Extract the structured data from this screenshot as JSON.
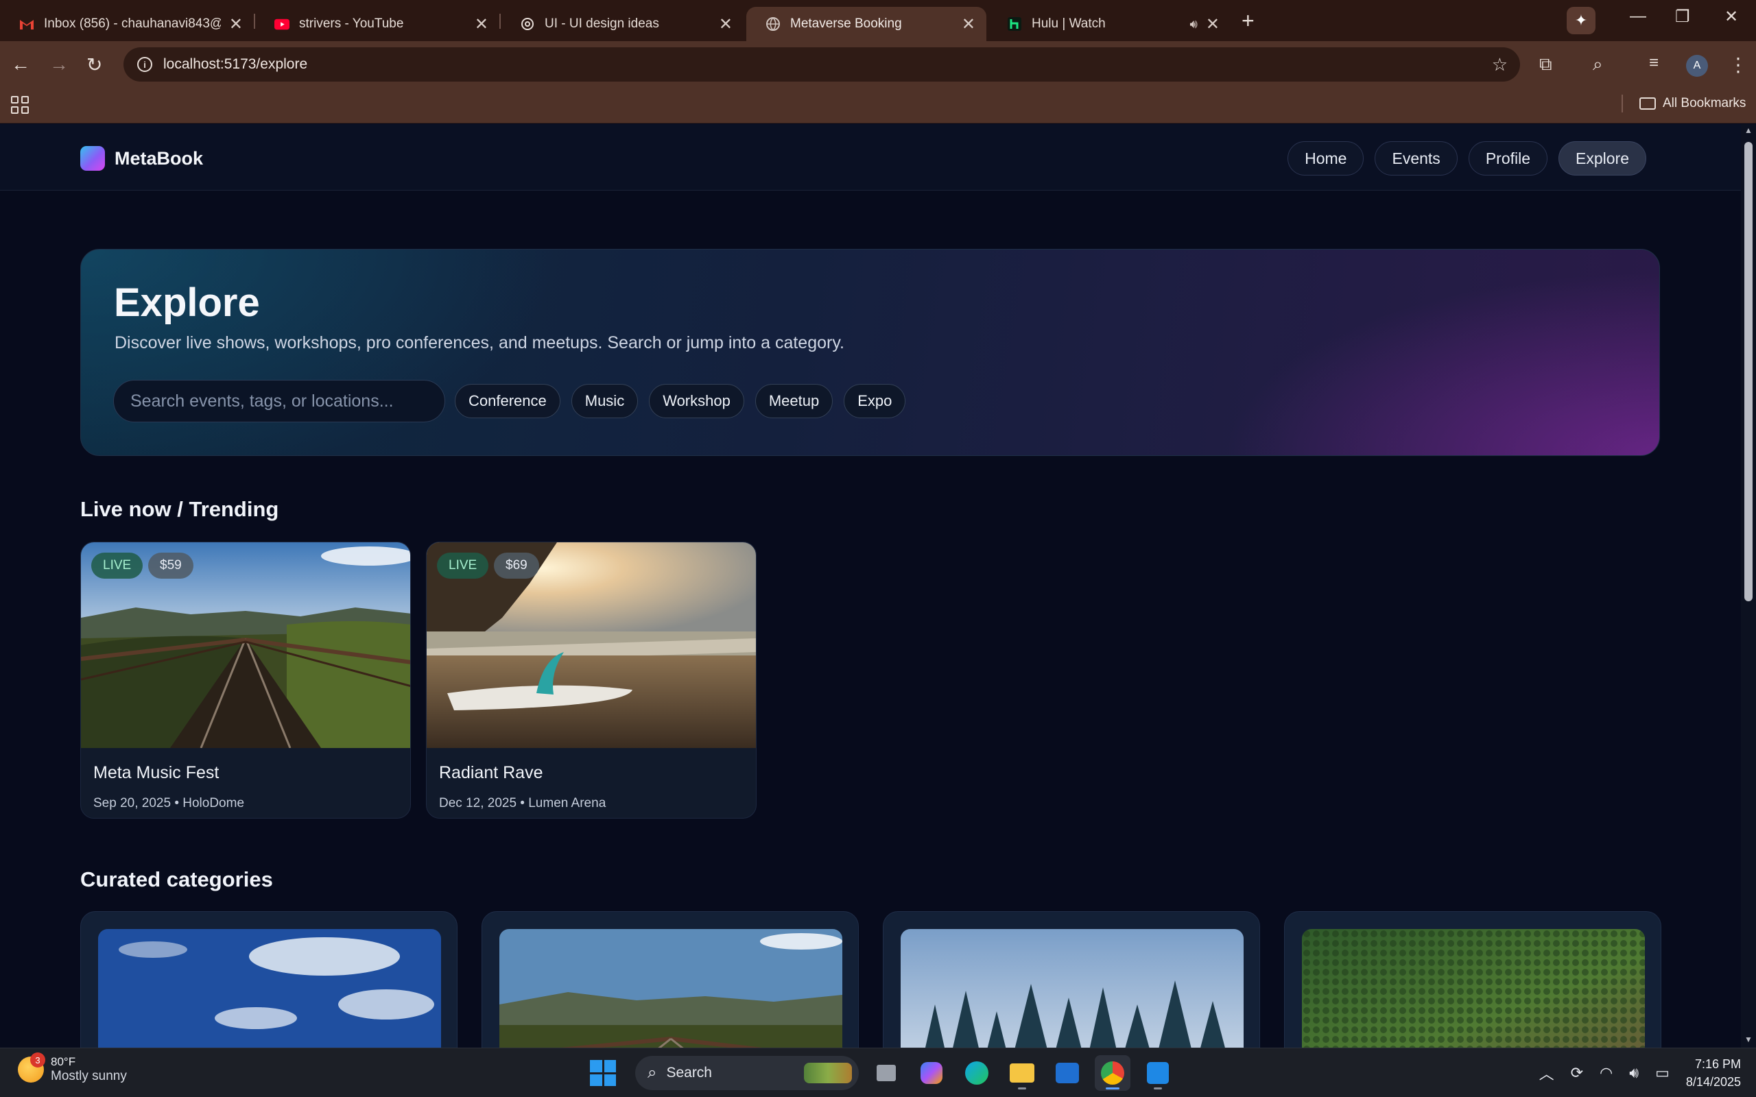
{
  "browser": {
    "tabs": [
      {
        "title": "Inbox (856) - chauhanavi843@g",
        "icon": "gmail-icon"
      },
      {
        "title": "strivers - YouTube",
        "icon": "youtube-icon"
      },
      {
        "title": "UI - UI design ideas",
        "icon": "openai-icon"
      },
      {
        "title": "Metaverse Booking",
        "icon": "globe-icon"
      },
      {
        "title": "Hulu | Watch",
        "icon": "hulu-icon"
      }
    ],
    "url": "localhost:5173/explore",
    "bookmarks_label": "All Bookmarks",
    "profile_initial": "A"
  },
  "site": {
    "logo": "MetaBook",
    "nav": [
      "Home",
      "Events",
      "Profile",
      "Explore"
    ],
    "active_nav": "Explore"
  },
  "hero": {
    "title": "Explore",
    "subtitle": "Discover live shows, workshops, pro conferences, and meetups. Search or jump into a category.",
    "search_placeholder": "Search events, tags, or locations...",
    "chips": [
      "Conference",
      "Music",
      "Workshop",
      "Meetup",
      "Expo"
    ]
  },
  "trending": {
    "title": "Live now / Trending",
    "events": [
      {
        "name": "Meta Music Fest",
        "date": "Sep 20, 2025",
        "venue": "HoloDome",
        "meta": "Sep 20, 2025 • HoloDome",
        "badge": "LIVE",
        "price": "$59",
        "image": "railway-bridge-landscape"
      },
      {
        "name": "Radiant Rave",
        "date": "Dec 12, 2025",
        "venue": "Lumen Arena",
        "meta": "Dec 12, 2025 • Lumen Arena",
        "badge": "LIVE",
        "price": "$69",
        "image": "beach-surfboard-sunset"
      }
    ]
  },
  "categories": {
    "title": "Curated categories",
    "images": [
      "blue-sky-clouds",
      "railway-bridge-landscape",
      "pine-forest",
      "aerial-forest"
    ]
  },
  "taskbar": {
    "weather_badge": "3",
    "temperature": "80°F",
    "condition": "Mostly sunny",
    "search_label": "Search",
    "time": "7:16 PM",
    "date": "8/14/2025"
  },
  "colors": {
    "page_bg": "#070b1c",
    "accent_gradient_start": "#35c2f0",
    "accent_gradient_end": "#d946ef",
    "live_badge_text": "#a7f0cf"
  }
}
